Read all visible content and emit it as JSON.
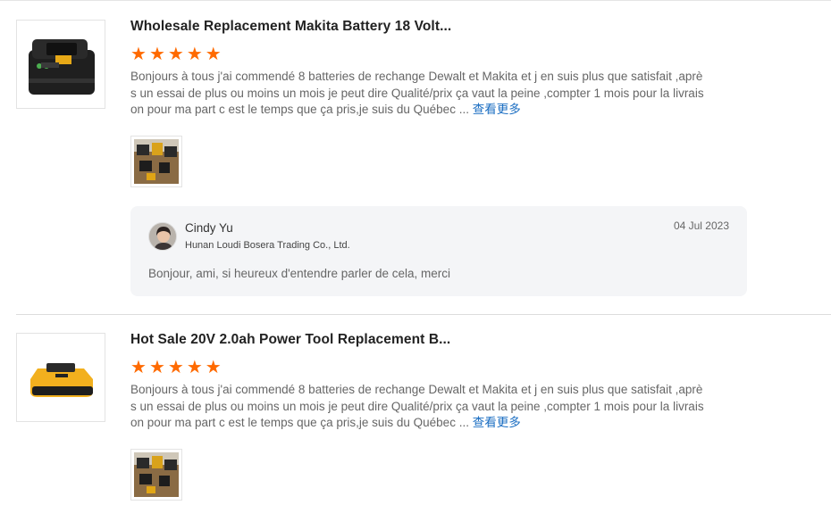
{
  "reviews": [
    {
      "product_title": "Wholesale Replacement Makita Battery 18 Volt...",
      "rating": 5,
      "rating_max": 5,
      "star_color": "#ff6a00",
      "body_lines": [
        "Bonjours à tous j'ai commendé 8 batteries de rechange Dewalt et Makita et j en suis plus que satisfait ,aprè",
        "s un essai de plus ou moins un mois je peut dire Qualité/prix ça vaut la peine ,compter 1 mois pour la livrais",
        "on pour ma part c est le temps que ça pris,je suis du Québec ..."
      ],
      "more_label": "查看更多",
      "reply": {
        "name": "Cindy Yu",
        "company": "Hunan Loudi Bosera Trading Co., Ltd.",
        "date": "04 Jul 2023",
        "text": "Bonjour, ami, si heureux d'entendre parler de cela, merci"
      }
    },
    {
      "product_title": "Hot Sale 20V 2.0ah Power Tool Replacement B...",
      "rating": 5,
      "rating_max": 5,
      "star_color": "#ff6a00",
      "body_lines": [
        "Bonjours à tous j'ai commendé 8 batteries de rechange Dewalt et Makita et j en suis plus que satisfait ,aprè",
        "s un essai de plus ou moins un mois je peut dire Qualité/prix ça vaut la peine ,compter 1 mois pour la livrais",
        "on pour ma part c est le temps que ça pris,je suis du Québec ..."
      ],
      "more_label": "查看更多"
    }
  ],
  "colors": {
    "accent_star": "#ff6a00",
    "link": "#1b6ec2"
  }
}
